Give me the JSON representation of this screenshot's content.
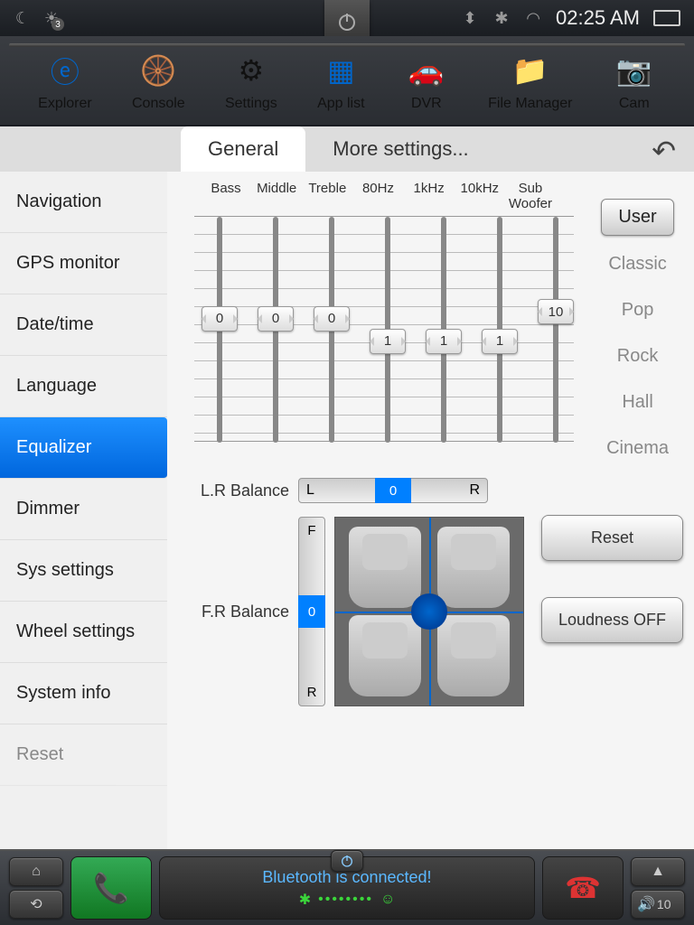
{
  "status": {
    "time": "02:25 AM",
    "badge": "3"
  },
  "dock": [
    {
      "label": "Explorer"
    },
    {
      "label": "Console"
    },
    {
      "label": "Settings"
    },
    {
      "label": "App list"
    },
    {
      "label": "DVR"
    },
    {
      "label": "File Manager"
    },
    {
      "label": "Cam"
    }
  ],
  "tabs": {
    "general": "General",
    "more": "More settings..."
  },
  "sidebar": [
    "Navigation",
    "GPS monitor",
    "Date/time",
    "Language",
    "Equalizer",
    "Dimmer",
    "Sys settings",
    "Wheel settings",
    "System info",
    "Reset"
  ],
  "eq": {
    "bands": [
      {
        "name": "Bass",
        "value": 0,
        "pos": 45
      },
      {
        "name": "Middle",
        "value": 0,
        "pos": 45
      },
      {
        "name": "Treble",
        "value": 0,
        "pos": 45
      },
      {
        "name": "80Hz",
        "value": 1,
        "pos": 55
      },
      {
        "name": "1kHz",
        "value": 1,
        "pos": 55
      },
      {
        "name": "10kHz",
        "value": 1,
        "pos": 55
      },
      {
        "name": "Sub Woofer",
        "value": 10,
        "pos": 42
      }
    ]
  },
  "presets": [
    "User",
    "Classic",
    "Pop",
    "Rock",
    "Hall",
    "Cinema"
  ],
  "balance": {
    "lr_label": "L.R Balance",
    "lr_value": 0,
    "L": "L",
    "R": "R",
    "fr_label": "F.R Balance",
    "fr_value": 0,
    "F": "F"
  },
  "actions": {
    "reset": "Reset",
    "loudness": "Loudness OFF"
  },
  "bottom": {
    "bt_status": "Bluetooth is connected!",
    "volume": "10"
  }
}
